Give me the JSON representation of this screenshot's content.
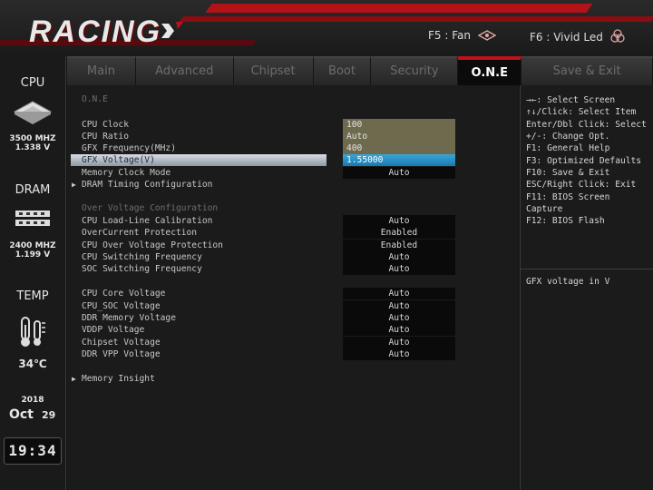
{
  "header": {
    "logo_text": "RACING",
    "f5": "F5 : Fan",
    "f6": "F6 : Vivid Led"
  },
  "sidebar": {
    "cpu_title": "CPU",
    "cpu_freq": "3500 MHZ",
    "cpu_volt": "1.338 V",
    "dram_title": "DRAM",
    "dram_freq": "2400 MHZ",
    "dram_volt": "1.199 V",
    "temp_title": "TEMP",
    "temp_value": "34℃",
    "year": "2018",
    "month": "Oct",
    "day": "29",
    "clock": "19:34"
  },
  "tabs": [
    {
      "label": "Main"
    },
    {
      "label": "Advanced"
    },
    {
      "label": "Chipset"
    },
    {
      "label": "Boot"
    },
    {
      "label": "Security"
    },
    {
      "label": "O.N.E"
    },
    {
      "label": "Save & Exit"
    }
  ],
  "main": {
    "section_title": "O.N.E",
    "rows": [
      {
        "label": "CPU Clock",
        "value": "100"
      },
      {
        "label": "CPU Ratio",
        "value": "Auto"
      },
      {
        "label": "GFX Frequency(MHz)",
        "value": "400"
      },
      {
        "label": "GFX Voltage(V)",
        "value": "1.55000"
      },
      {
        "label": "Memory Clock Mode",
        "value": "Auto"
      }
    ],
    "dram_timing": "DRAM Timing Configuration",
    "ov_title": "Over Voltage Configuration",
    "ov_rows": [
      {
        "label": "CPU Load-Line Calibration",
        "value": "Auto"
      },
      {
        "label": "OverCurrent Protection",
        "value": "Enabled"
      },
      {
        "label": "CPU Over Voltage Protection",
        "value": "Enabled"
      },
      {
        "label": "CPU Switching Frequency",
        "value": "Auto"
      },
      {
        "label": "SOC Switching Frequency",
        "value": "Auto"
      }
    ],
    "volt_rows": [
      {
        "label": "CPU Core Voltage",
        "value": "Auto"
      },
      {
        "label": "CPU_SOC Voltage",
        "value": "Auto"
      },
      {
        "label": "DDR Memory Voltage",
        "value": "Auto"
      },
      {
        "label": "VDDP Voltage",
        "value": "Auto"
      },
      {
        "label": "Chipset Voltage",
        "value": "Auto"
      },
      {
        "label": "DDR VPP Voltage",
        "value": "Auto"
      }
    ],
    "memory_insight": "Memory Insight"
  },
  "help": {
    "lines": [
      "→←: Select Screen",
      "↑↓/Click: Select Item",
      "Enter/Dbl Click: Select",
      "+/-: Change Opt.",
      "F1: General Help",
      "F3: Optimized Defaults",
      "F10: Save & Exit",
      "ESC/Right Click: Exit",
      "F11: BIOS Screen",
      "Capture",
      "F12: BIOS Flash"
    ],
    "description": "GFX voltage in V"
  },
  "colors": {
    "accent": "#c0111a",
    "selected_value": "#1a78b0",
    "editable_value": "#6e6a4e"
  }
}
